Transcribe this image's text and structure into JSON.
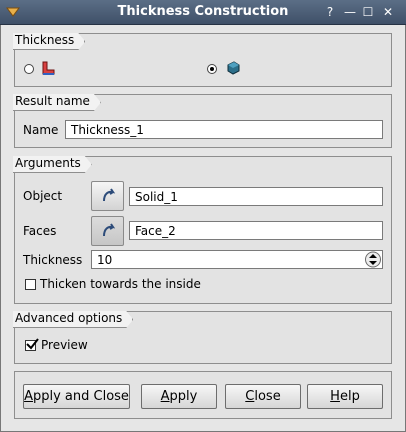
{
  "window": {
    "title": "Thickness Construction",
    "help_label": "?",
    "minimize_label": "—",
    "maximize_label": "☐",
    "close_label": "✕"
  },
  "thickness_group": {
    "title": "Thickness"
  },
  "result_group": {
    "title": "Result name",
    "name_label": "Name",
    "name_value": "Thickness_1"
  },
  "arguments_group": {
    "title": "Arguments",
    "object_label": "Object",
    "object_value": "Solid_1",
    "faces_label": "Faces",
    "faces_value": "Face_2",
    "thickness_label": "Thickness",
    "thickness_value": "10",
    "inside_label": "Thicken towards the inside"
  },
  "advanced_group": {
    "title": "Advanced options",
    "preview_label": "Preview"
  },
  "buttons": {
    "apply_close": {
      "before": "",
      "key": "A",
      "after": "pply and Close"
    },
    "apply": {
      "before": "",
      "key": "A",
      "after": "pply"
    },
    "close": {
      "before": "",
      "key": "C",
      "after": "lose"
    },
    "help": {
      "before": "",
      "key": "H",
      "after": "elp"
    }
  }
}
